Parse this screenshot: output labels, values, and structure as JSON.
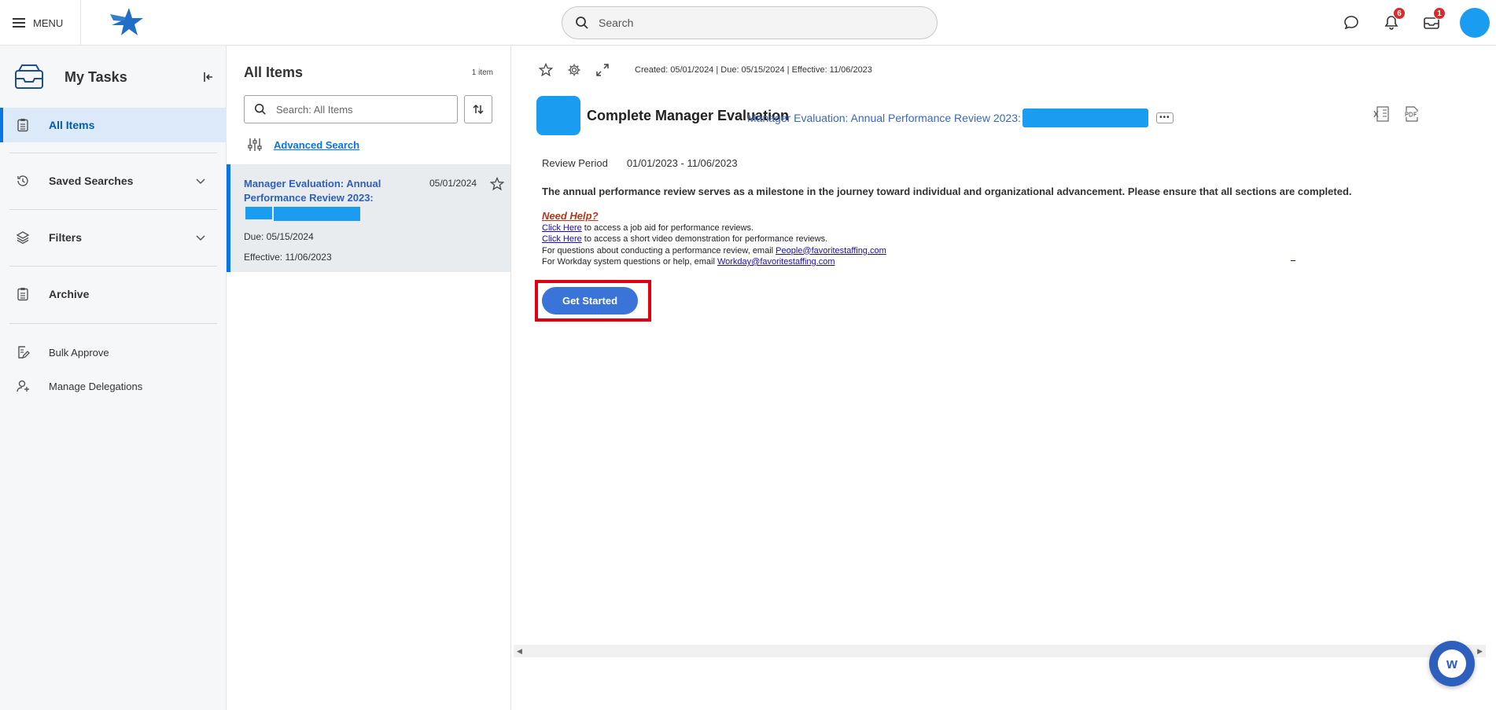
{
  "topbar": {
    "menu_label": "MENU",
    "search_placeholder": "Search",
    "notifications_count": "6",
    "inbox_count": "1"
  },
  "sidebar": {
    "title": "My Tasks",
    "items": [
      {
        "label": "All Items",
        "icon": "clipboard-icon",
        "active": true
      },
      {
        "label": "Saved Searches",
        "icon": "history-icon",
        "expandable": true
      },
      {
        "label": "Filters",
        "icon": "layers-icon",
        "expandable": true
      },
      {
        "label": "Archive",
        "icon": "clipboard-icon"
      },
      {
        "label": "Bulk Approve",
        "icon": "edit-document-icon"
      },
      {
        "label": "Manage Delegations",
        "icon": "person-icon"
      }
    ]
  },
  "list": {
    "title": "All Items",
    "count": "1 item",
    "search_placeholder": "Search: All Items",
    "advanced_search": "Advanced Search",
    "cards": [
      {
        "title": "Manager Evaluation: Annual Performance Review 2023:",
        "date": "05/01/2024",
        "due": "Due: 05/15/2024",
        "effective": "Effective: 11/06/2023"
      }
    ]
  },
  "detail": {
    "meta": "Created: 05/01/2024 | Due: 05/15/2024 | Effective: 11/06/2023",
    "title": "Complete Manager Evaluation",
    "subject": "Manager Evaluation: Annual Performance Review 2023:",
    "review_period_label": "Review Period",
    "review_period_value": "01/01/2023 - 11/06/2023",
    "intro": "The annual performance review serves as a milestone in the journey toward individual and organizational advancement. Please ensure that all sections are completed.",
    "need_help": "Need Help?",
    "help_lines": {
      "line1_link": "Click Here",
      "line1_text": " to access a job aid for performance reviews.",
      "line2_link": "Click Here",
      "line2_text": " to access a short video demonstration for performance reviews.",
      "line3_text": "For questions about conducting a performance review, email ",
      "line3_link": "People@favoritestaffing.com",
      "line4_text": "For Workday system questions or help, email ",
      "line4_link": "Workday@favoritestaffing.com "
    },
    "get_started": "Get Started"
  },
  "colors": {
    "accent": "#0875e1",
    "highlight": "#e00012",
    "button": "#3a74d9",
    "redaction": "#1a9cf0"
  }
}
